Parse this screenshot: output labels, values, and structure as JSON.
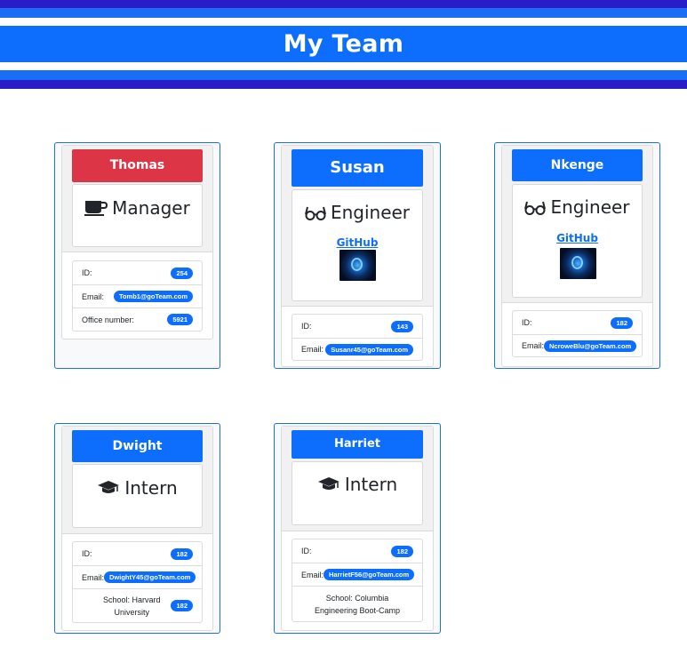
{
  "page": {
    "title": "My Team"
  },
  "colors": {
    "primary": "#0d6efd",
    "danger": "#dc3545",
    "navy": "#2a1dc7"
  },
  "team": [
    {
      "name": "Thomas",
      "role": "Manager",
      "role_icon": "coffee-icon",
      "header_color": "#dc3545",
      "id_label": "ID:",
      "id": "254",
      "email_label": "Email:",
      "email": "Tomb1@goTeam.com",
      "extra_label": "Office number:",
      "extra_value": "5921"
    },
    {
      "name": "Susan",
      "role": "Engineer",
      "role_icon": "glasses-icon",
      "header_color": "#0d6efd",
      "github_label": "GitHub",
      "id_label": "ID:",
      "id": "143",
      "email_label": "Email:",
      "email": "Susanr45@goTeam.com"
    },
    {
      "name": "Nkenge",
      "role": "Engineer",
      "role_icon": "glasses-icon",
      "header_color": "#0d6efd",
      "github_label": "GitHub",
      "id_label": "ID:",
      "id": "182",
      "email_label": "Email:",
      "email": "NcroweBlu@goTeam.com"
    },
    {
      "name": "Dwight",
      "role": "Intern",
      "role_icon": "graduation-cap-icon",
      "header_color": "#0d6efd",
      "id_label": "ID:",
      "id": "182",
      "email_label": "Email:",
      "email": "DwightY45@goTeam.com",
      "extra_label": "School: Harvard University",
      "extra_value": "182"
    },
    {
      "name": "Harriet",
      "role": "Intern",
      "role_icon": "graduation-cap-icon",
      "header_color": "#0d6efd",
      "id_label": "ID:",
      "id": "182",
      "email_label": "Email:",
      "email": "HarrietF56@goTeam.com",
      "extra_label": "School: Columbia Engineering Boot-Camp"
    }
  ]
}
